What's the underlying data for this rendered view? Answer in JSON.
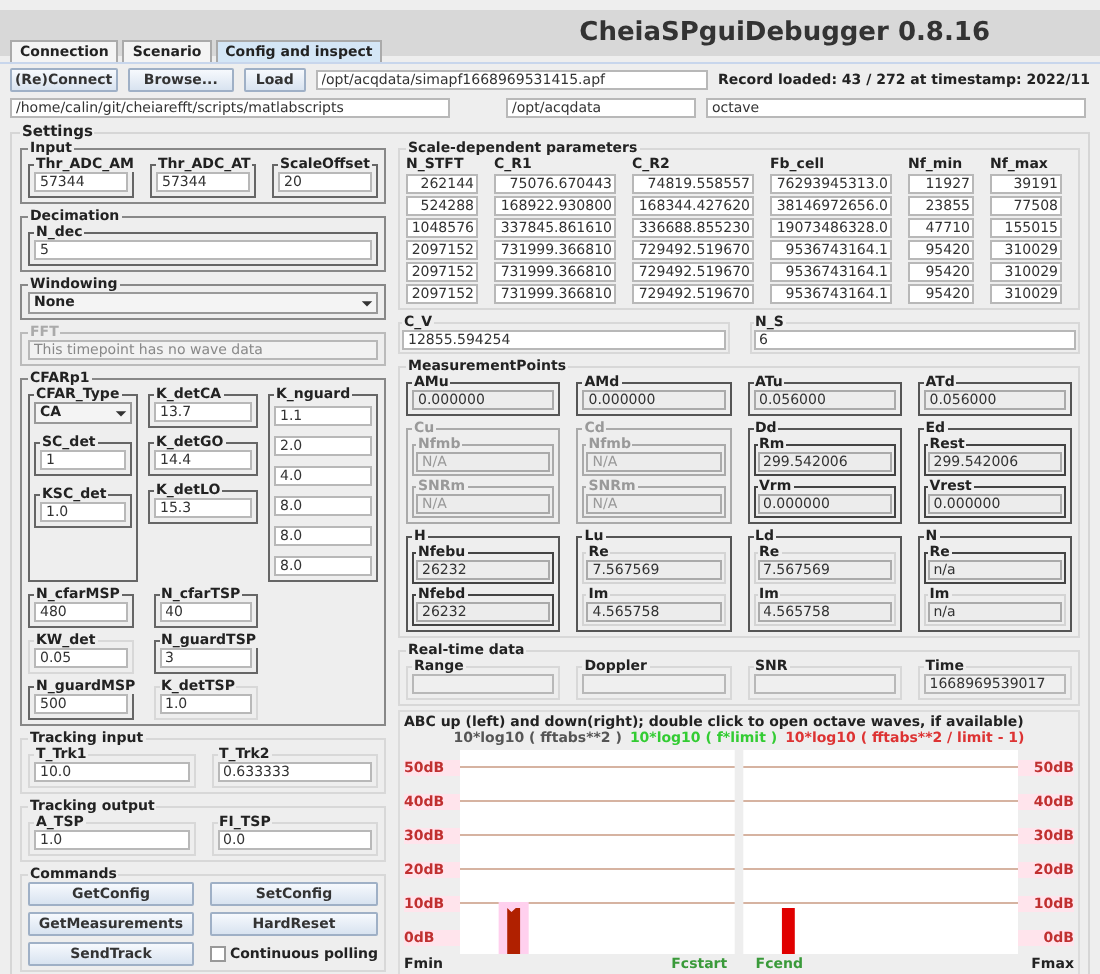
{
  "title": "CheiaSPguiDebugger 0.8.16",
  "tabs": [
    {
      "label": "Connection",
      "selected": false
    },
    {
      "label": "Scenario",
      "selected": false
    },
    {
      "label": "Config and inspect",
      "selected": true
    }
  ],
  "toolbar": {
    "buttons": [
      "(Re)Connect",
      "Browse...",
      "Load"
    ],
    "file_path": "/opt/acqdata/simapf1668969531415.apf",
    "status": "Record loaded: 43 / 272 at timestamp: 2022/11"
  },
  "paths": [
    "/home/calin/git/cheiarefft/scripts/matlabscripts",
    "/opt/acqdata",
    "octave"
  ],
  "settings": {
    "title": "Settings",
    "input": {
      "title": "Input",
      "fields": [
        {
          "label": "Thr_ADC_AM",
          "value": "57344"
        },
        {
          "label": "Thr_ADC_AT",
          "value": "57344"
        },
        {
          "label": "ScaleOffset",
          "value": "20"
        }
      ]
    },
    "decimation": {
      "title": "Decimation",
      "label": "N_dec",
      "value": "5"
    },
    "windowing": {
      "title": "Windowing",
      "value": "None"
    },
    "fft": {
      "title": "FFT",
      "value": "This timepoint has no wave data",
      "disabled": true
    },
    "cfar": {
      "title": "CFARp1",
      "type": {
        "label": "CFAR_Type",
        "value": "CA"
      },
      "col1": [
        {
          "label": "SC_det",
          "value": "1"
        },
        {
          "label": "KSC_det",
          "value": "1.0"
        }
      ],
      "col2": [
        {
          "label": "K_detCA",
          "value": "13.7"
        },
        {
          "label": "K_detGO",
          "value": "14.4"
        },
        {
          "label": "K_detLO",
          "value": "15.3"
        }
      ],
      "nguard": {
        "label": "K_nguard",
        "values": [
          "1.1",
          "2.0",
          "4.0",
          "8.0",
          "8.0",
          "8.0"
        ]
      },
      "bottom": [
        {
          "label": "N_cfarMSP",
          "value": "480",
          "framed": true
        },
        {
          "label": "N_cfarTSP",
          "value": "40",
          "framed": true
        },
        {
          "label": "KW_det",
          "value": "0.05",
          "framed": false
        },
        {
          "label": "N_guardTSP",
          "value": "3",
          "framed": true
        },
        {
          "label": "N_guardMSP",
          "value": "500",
          "framed": true
        },
        {
          "label": "K_detTSP",
          "value": "1.0",
          "framed": false
        }
      ]
    },
    "tracking_input": {
      "title": "Tracking input",
      "fields": [
        {
          "label": "T_Trk1",
          "value": "10.0"
        },
        {
          "label": "T_Trk2",
          "value": "0.633333"
        }
      ]
    },
    "tracking_output": {
      "title": "Tracking output",
      "fields": [
        {
          "label": "A_TSP",
          "value": "1.0"
        },
        {
          "label": "FI_TSP",
          "value": "0.0"
        }
      ]
    },
    "commands": {
      "title": "Commands",
      "buttons": [
        "GetConfig",
        "SetConfig",
        "GetMeasurements",
        "HardReset",
        "SendTrack"
      ],
      "polling": {
        "label": "Continuous polling",
        "checked": false
      }
    },
    "scale_params": {
      "title": "Scale-dependent parameters",
      "columns": [
        "N_STFT",
        "C_R1",
        "C_R2",
        "Fb_cell",
        "Nf_min",
        "Nf_max"
      ],
      "rows": [
        [
          "262144",
          "75076.670443",
          "74819.558557",
          "76293945313.0",
          "11927",
          "39191"
        ],
        [
          "524288",
          "168922.930800",
          "168344.427620",
          "38146972656.0",
          "23855",
          "77508"
        ],
        [
          "1048576",
          "337845.861610",
          "336688.855230",
          "19073486328.0",
          "47710",
          "155015"
        ],
        [
          "2097152",
          "731999.366810",
          "729492.519670",
          "9536743164.1",
          "95420",
          "310029"
        ],
        [
          "2097152",
          "731999.366810",
          "729492.519670",
          "9536743164.1",
          "95420",
          "310029"
        ],
        [
          "2097152",
          "731999.366810",
          "729492.519670",
          "9536743164.1",
          "95420",
          "310029"
        ]
      ]
    },
    "cv": {
      "label": "C_V",
      "value": "12855.594254"
    },
    "ns": {
      "label": "N_S",
      "value": "6"
    },
    "measurement_points": {
      "title": "MeasurementPoints",
      "groups": [
        {
          "title": "AMu",
          "kind": "single",
          "disabled": false,
          "value": "0.000000"
        },
        {
          "title": "AMd",
          "kind": "single",
          "disabled": false,
          "value": "0.000000"
        },
        {
          "title": "ATu",
          "kind": "single",
          "disabled": false,
          "value": "0.056000"
        },
        {
          "title": "ATd",
          "kind": "single",
          "disabled": false,
          "value": "0.056000"
        },
        {
          "title": "Cu",
          "kind": "pair",
          "disabled": true,
          "fields": [
            {
              "label": "Nfmb",
              "value": "N/A",
              "framed": true
            },
            {
              "label": "SNRm",
              "value": "N/A",
              "framed": true
            }
          ]
        },
        {
          "title": "Cd",
          "kind": "pair",
          "disabled": true,
          "fields": [
            {
              "label": "Nfmb",
              "value": "N/A",
              "framed": true
            },
            {
              "label": "SNRm",
              "value": "N/A",
              "framed": true
            }
          ]
        },
        {
          "title": "Dd",
          "kind": "pair",
          "disabled": false,
          "fields": [
            {
              "label": "Rm",
              "value": "299.542006",
              "framed": true
            },
            {
              "label": "Vrm",
              "value": "0.000000",
              "framed": true
            }
          ]
        },
        {
          "title": "Ed",
          "kind": "pair",
          "disabled": false,
          "fields": [
            {
              "label": "Rest",
              "value": "299.542006",
              "framed": true
            },
            {
              "label": "Vrest",
              "value": "0.000000",
              "framed": true
            }
          ]
        },
        {
          "title": "H",
          "kind": "pair",
          "disabled": false,
          "fields": [
            {
              "label": "Nfebu",
              "value": "26232",
              "framed": true
            },
            {
              "label": "Nfebd",
              "value": "26232",
              "framed": true
            }
          ]
        },
        {
          "title": "Lu",
          "kind": "pair",
          "disabled": false,
          "fields": [
            {
              "label": "Re",
              "value": "7.567569",
              "framed": false
            },
            {
              "label": "Im",
              "value": "4.565758",
              "framed": false
            }
          ]
        },
        {
          "title": "Ld",
          "kind": "pair",
          "disabled": false,
          "fields": [
            {
              "label": "Re",
              "value": "7.567569",
              "framed": false
            },
            {
              "label": "Im",
              "value": "4.565758",
              "framed": false
            }
          ]
        },
        {
          "title": "N",
          "kind": "pair",
          "disabled": false,
          "fields": [
            {
              "label": "Re",
              "value": "n/a",
              "framed": true
            },
            {
              "label": "Im",
              "value": "n/a",
              "framed": false
            }
          ]
        }
      ]
    },
    "realtime": {
      "title": "Real-time data",
      "fields": [
        {
          "label": "Range"
        },
        {
          "label": "Doppler"
        },
        {
          "label": "SNR"
        },
        {
          "label": "Time",
          "value": "1668969539017"
        }
      ]
    },
    "chart": {
      "title": "ABC up (left) and down(right); double click to open octave waves, if available)",
      "legend": [
        {
          "text": "10*log10 ( fftabs**2 )",
          "color": "#555555"
        },
        {
          "text": "10*log10 ( f*limit )",
          "color": "#33cc33"
        },
        {
          "text": "10*log10 ( fftabs**2 / limit - 1)",
          "color": "#dd3333"
        }
      ],
      "y_ticks_left": [
        "50dB",
        "40dB",
        "30dB",
        "20dB",
        "10dB",
        "0dB"
      ],
      "y_ticks_right": [
        "50dB",
        "40dB",
        "30dB",
        "20dB",
        "10dB",
        "0dB"
      ],
      "x_labels": [
        {
          "text": "Fmin",
          "color": "#222222"
        },
        {
          "text": "Fcstart",
          "color": "#3a9a3a"
        },
        {
          "text": "Fcend",
          "color": "#3a9a3a"
        },
        {
          "text": "Fmax",
          "color": "#222222"
        }
      ]
    }
  }
}
